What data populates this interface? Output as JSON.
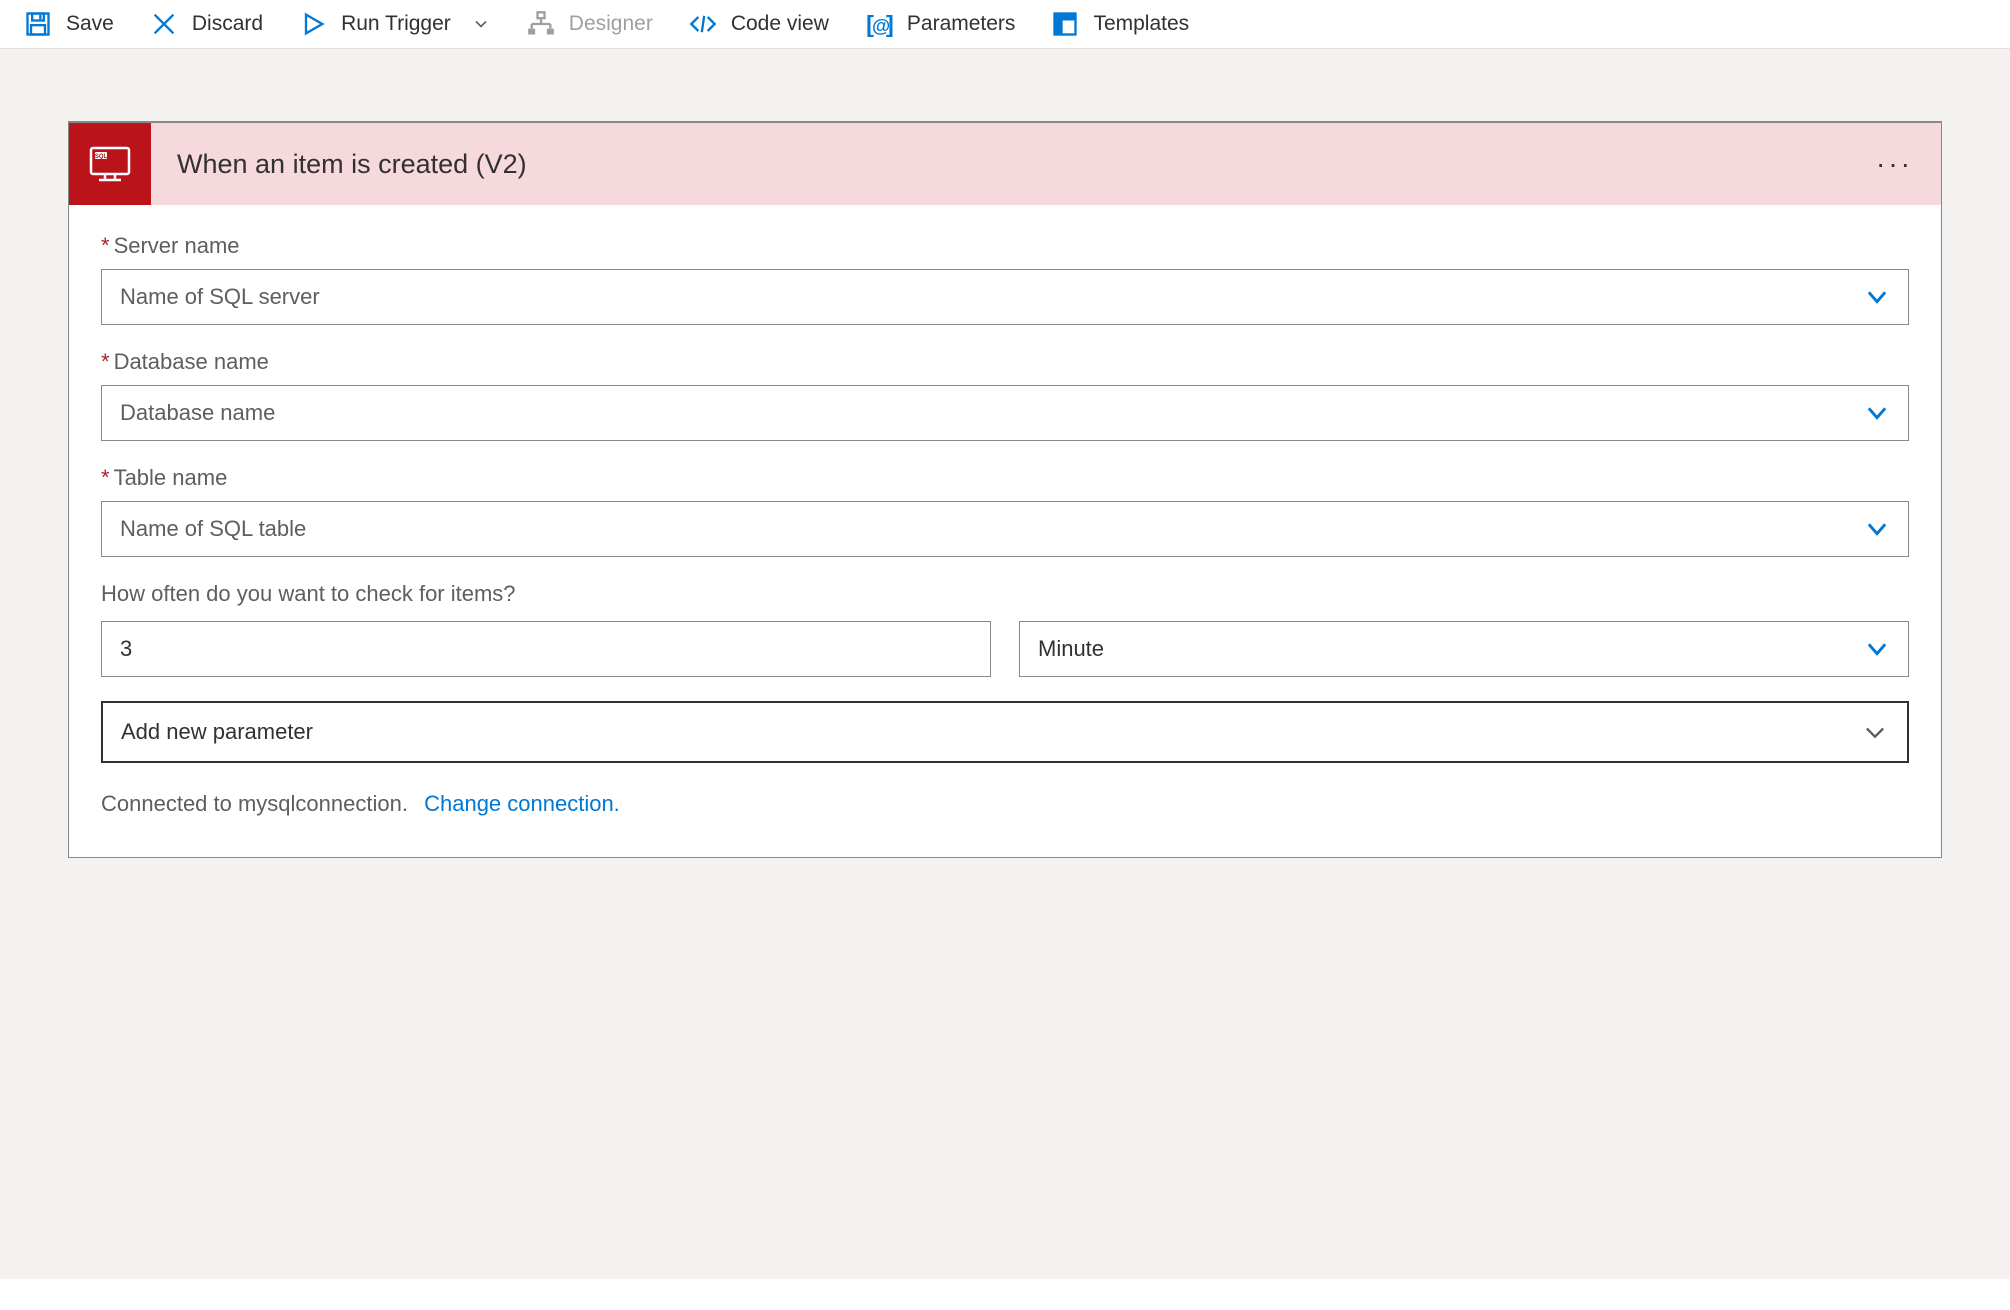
{
  "toolbar": {
    "save": "Save",
    "discard": "Discard",
    "runTrigger": "Run Trigger",
    "designer": "Designer",
    "codeView": "Code view",
    "parameters": "Parameters",
    "templates": "Templates"
  },
  "card": {
    "title": "When an item is created (V2)",
    "fields": {
      "serverName": {
        "label": "Server name",
        "placeholder": "Name of SQL server"
      },
      "databaseName": {
        "label": "Database name",
        "placeholder": "Database name"
      },
      "tableName": {
        "label": "Table name",
        "placeholder": "Name of SQL table"
      },
      "frequency": {
        "label": "How often do you want to check for items?",
        "interval": "3",
        "unit": "Minute"
      }
    },
    "addParameter": "Add new parameter",
    "connectedPrefix": "Connected to mysqlconnection.",
    "changeConnection": "Change connection."
  }
}
